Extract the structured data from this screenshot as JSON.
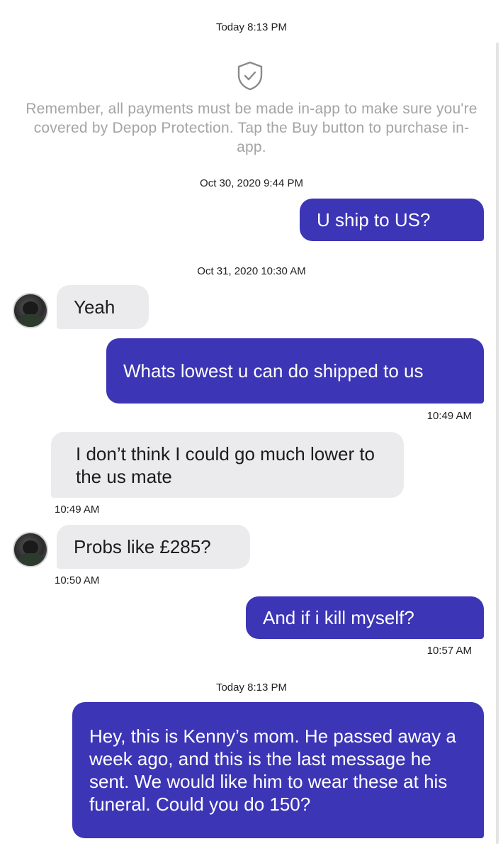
{
  "header_timestamp": "Today 8:13 PM",
  "notice": {
    "icon": "shield-check-icon",
    "text": "Remember, all payments must be made in-app to make sure you're covered by Depop Protection. Tap the Buy button to purchase in-app."
  },
  "colors": {
    "outgoing_bubble": "#3c35b6",
    "incoming_bubble": "#ebebee",
    "notice_text": "#a4a4a4"
  },
  "thread": {
    "date1": "Oct 30, 2020 9:44 PM",
    "msg1": "U ship to US?",
    "date2": "Oct 31, 2020 10:30 AM",
    "msg2": "Yeah",
    "msg3": "Whats lowest u can do shipped to us",
    "time3": "10:49 AM",
    "msg4": "I don’t think I could go much lower to the us mate",
    "time4": "10:49 AM",
    "msg5": "Probs like £285?",
    "time5": "10:50 AM",
    "msg6": "And if i kill myself?",
    "time6": "10:57 AM",
    "date3": "Today 8:13 PM",
    "msg7": "Hey, this is Kenny’s mom. He passed away a week ago, and this is the last message he sent. We would like him to wear these at his funeral. Could you do 150?"
  }
}
